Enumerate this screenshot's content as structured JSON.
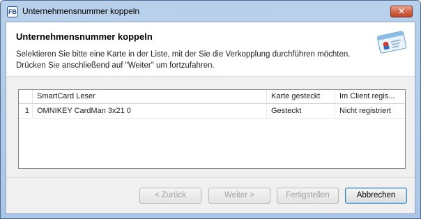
{
  "window": {
    "title": "Unternehmensnummer koppeln",
    "app_icon_text": "FB",
    "close_symbol": "✕"
  },
  "header": {
    "title": "Unternehmensnummer koppeln",
    "description_line1": "Selektieren Sie bitte eine Karte in der Liste, mit der Sie die Verkopplung durchführen möchten.",
    "description_line2": "Drücken Sie anschließend auf \"Weiter\" um fortzufahren.",
    "icon": "id-card-icon"
  },
  "grid": {
    "columns": [
      "SmartCard Leser",
      "Karte gesteckt",
      "Im Client regis..."
    ],
    "rows": [
      {
        "index": "1",
        "reader": "OMNIKEY CardMan 3x21 0",
        "inserted": "Gesteckt",
        "registered": "Nicht registriert"
      }
    ]
  },
  "buttons": {
    "back": "< Zurück",
    "next": "Weiter >",
    "finish": "Fertigstellen",
    "cancel": "Abbrechen"
  },
  "colors": {
    "titlebar": "#b9d1ea",
    "close": "#c0462a",
    "header_bg": "#ffffff"
  }
}
